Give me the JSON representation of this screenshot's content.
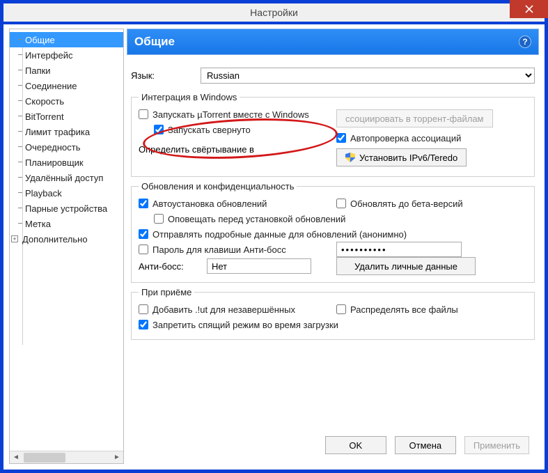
{
  "window": {
    "title": "Настройки"
  },
  "sidebar": {
    "items": [
      "Общие",
      "Интерфейс",
      "Папки",
      "Соединение",
      "Скорость",
      "BitTorrent",
      "Лимит трафика",
      "Очередность",
      "Планировщик",
      "Удалённый доступ",
      "Playback",
      "Парные устройства",
      "Метка"
    ],
    "root": "Дополнительно"
  },
  "panel": {
    "header": "Общие",
    "help_tip": "?",
    "lang_label": "Язык:",
    "lang_value": "Russian",
    "group_integration": "Интеграция в Windows",
    "chk_start_with_windows": "Запускать µTorrent вместе с Windows",
    "chk_start_minimized": "Запускать свернуто",
    "btn_assoc_torrent": "ссоциировать в торрент-файлам",
    "chk_auto_assoc": "Автопроверка ассоциаций",
    "lbl_minimize_as": "Определить свёртывание в",
    "btn_ipv6": "Установить IPv6/Teredo",
    "group_updates": "Обновления и конфиденциальность",
    "chk_auto_update": "Автоустановка обновлений",
    "chk_beta": "Обновлять до бета-версий",
    "chk_notify_update": "Оповещать перед установкой обновлений",
    "chk_send_detail": "Отправлять подробные данные для обновлений (анонимно)",
    "chk_boss_pwd": "Пароль для клавиши Анти-босс",
    "lbl_boss": "Анти-босс:",
    "boss_value": "Нет",
    "pwd_value": "••••••••••",
    "btn_clear": "Удалить личные данные",
    "group_receive": "При приёме",
    "chk_addut": "Добавить .!ut для незавершённых",
    "chk_prealloc": "Распределять все файлы",
    "chk_no_sleep": "Запретить спящий режим во время загрузки"
  },
  "footer": {
    "ok": "OK",
    "cancel": "Отмена",
    "apply": "Применить"
  }
}
